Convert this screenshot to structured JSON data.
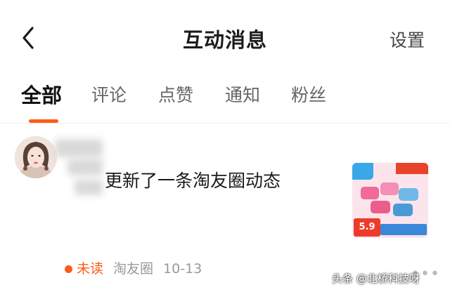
{
  "header": {
    "title": "互动消息",
    "settings_label": "设置",
    "back_icon": "chevron-left-icon"
  },
  "tabs": [
    {
      "label": "全部",
      "active": true
    },
    {
      "label": "评论",
      "active": false
    },
    {
      "label": "点赞",
      "active": false
    },
    {
      "label": "通知",
      "active": false
    },
    {
      "label": "粉丝",
      "active": false
    }
  ],
  "messages": [
    {
      "text": "更新了一条淘友圈动态",
      "status": "未读",
      "source": "淘友圈",
      "date": "10-13",
      "price": "5.9"
    }
  ],
  "watermark": "头条 @北桥科技呀",
  "colors": {
    "accent": "#ff5a1a",
    "text_primary": "#1a1a1a",
    "text_secondary": "#999999"
  }
}
